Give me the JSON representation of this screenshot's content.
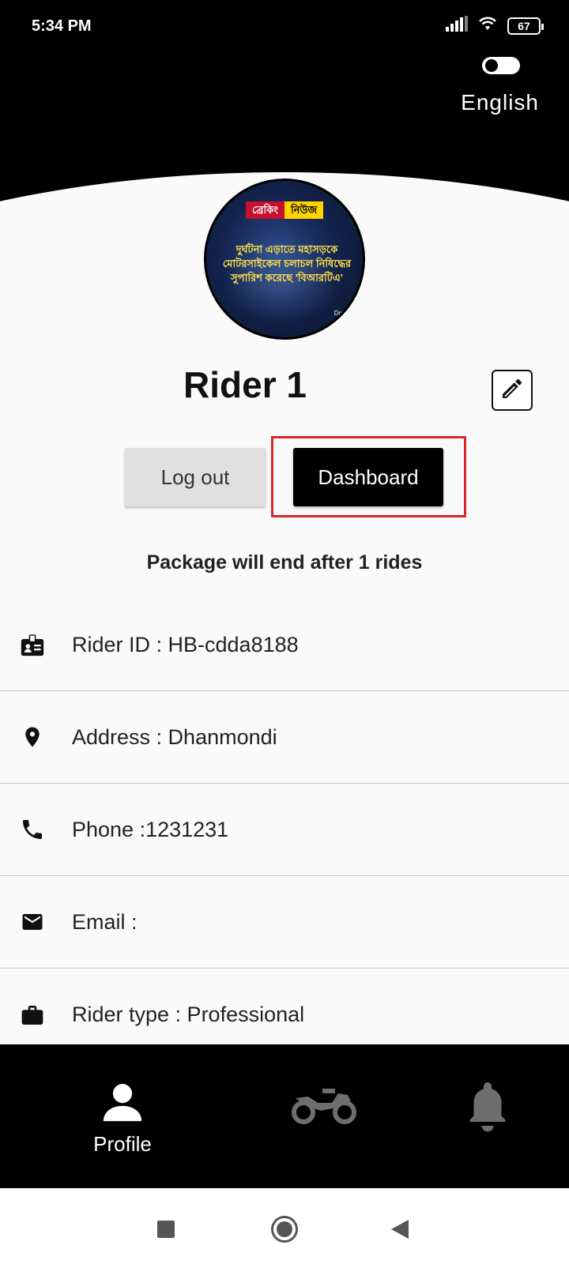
{
  "status_bar": {
    "time": "5:34 PM",
    "battery": "67",
    "icons": [
      "signal-icon",
      "wifi-icon",
      "battery-icon"
    ]
  },
  "language": {
    "label": "English",
    "toggle_on": false
  },
  "avatar": {
    "badge_left": "ব্রেকিং",
    "badge_right": "নিউজ",
    "headline": "দুর্ঘটনা এড়াতে মহাসড়কে মোটরসাইকেল চলাচল নিষিদ্ধের সুপারিশ করেছে 'বিআরটিএ'",
    "corner_text": "Downl"
  },
  "profile": {
    "name": "Rider 1",
    "edit_icon": "pencil-icon"
  },
  "actions": {
    "logout_label": "Log out",
    "dashboard_label": "Dashboard"
  },
  "package_text": "Package will end after 1 rides",
  "info": {
    "rider_id": "Rider ID : HB-cdda8188",
    "address": "Address : Dhanmondi",
    "phone": "Phone :1231231",
    "email": "Email :",
    "rider_type": "Rider type : Professional"
  },
  "bottom_nav": {
    "profile_label": "Profile",
    "items": [
      "person-icon",
      "motorcycle-icon",
      "bell-icon"
    ]
  },
  "colors": {
    "primary": "#000000",
    "background": "#fafafa",
    "highlight": "#d9262c",
    "inactive": "#6e6e6e"
  }
}
